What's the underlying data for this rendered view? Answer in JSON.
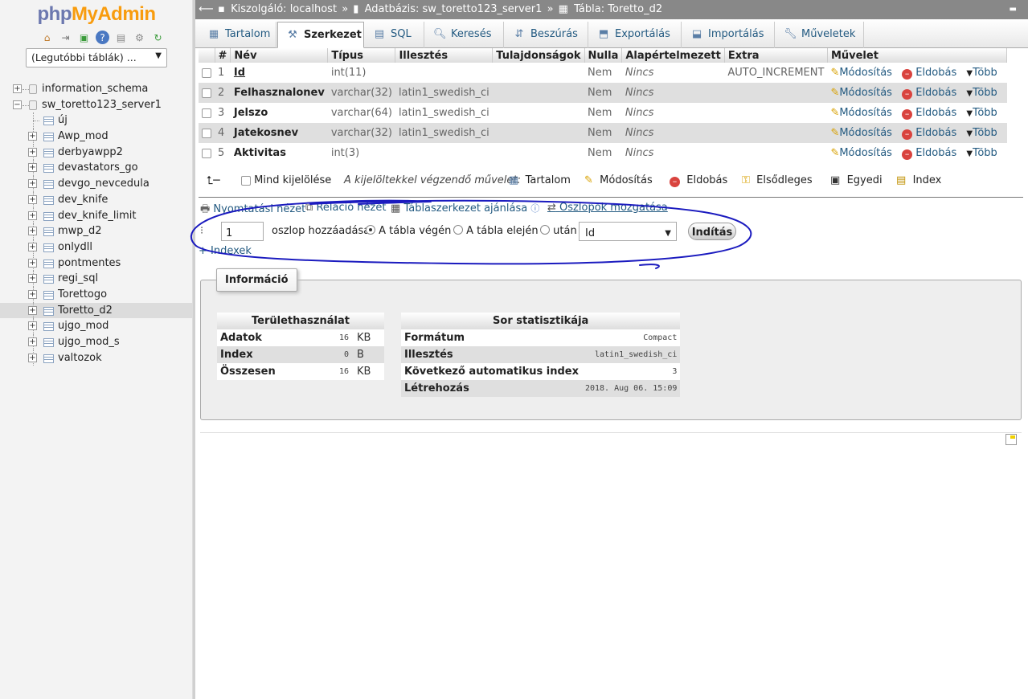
{
  "logo": {
    "php": "php",
    "myadmin": "MyAdmin"
  },
  "nav": {
    "recent_tables": "(Legutóbbi táblák) ...",
    "tree": [
      {
        "label": "information_schema",
        "kind": "db",
        "expanded": false
      },
      {
        "label": "sw_toretto123_server1",
        "kind": "db",
        "expanded": true
      },
      {
        "label": "új",
        "kind": "new"
      },
      {
        "label": "Awp_mod",
        "kind": "table"
      },
      {
        "label": "derbyawpp2",
        "kind": "table"
      },
      {
        "label": "devastators_go",
        "kind": "table"
      },
      {
        "label": "devgo_nevcedula",
        "kind": "table"
      },
      {
        "label": "dev_knife",
        "kind": "table"
      },
      {
        "label": "dev_knife_limit",
        "kind": "table"
      },
      {
        "label": "mwp_d2",
        "kind": "table"
      },
      {
        "label": "onlydll",
        "kind": "table"
      },
      {
        "label": "pontmentes",
        "kind": "table"
      },
      {
        "label": "regi_sql",
        "kind": "table"
      },
      {
        "label": "Torettogo",
        "kind": "table"
      },
      {
        "label": "Toretto_d2",
        "kind": "table",
        "selected": true
      },
      {
        "label": "ujgo_mod",
        "kind": "table"
      },
      {
        "label": "ujgo_mod_s",
        "kind": "table"
      },
      {
        "label": "valtozok",
        "kind": "table"
      }
    ]
  },
  "breadcrumb": {
    "server": "Kiszolgáló: localhost",
    "database": "Adatbázis: sw_toretto123_server1",
    "table": "Tábla: Toretto_d2"
  },
  "tabs": [
    {
      "label": "Tartalom",
      "icon": "table-icon"
    },
    {
      "label": "Szerkezet",
      "icon": "structure-icon",
      "active": true
    },
    {
      "label": "SQL",
      "icon": "sql-icon"
    },
    {
      "label": "Keresés",
      "icon": "search-icon"
    },
    {
      "label": "Beszúrás",
      "icon": "insert-icon"
    },
    {
      "label": "Exportálás",
      "icon": "export-icon"
    },
    {
      "label": "Importálás",
      "icon": "import-icon"
    },
    {
      "label": "Műveletek",
      "icon": "wrench-icon"
    }
  ],
  "structure": {
    "headers": [
      "#",
      "Név",
      "Típus",
      "Illesztés",
      "Tulajdonságok",
      "Nulla",
      "Alapértelmezett",
      "Extra",
      "Művelet"
    ],
    "rows": [
      {
        "num": "1",
        "name": "Id",
        "type": "int(11)",
        "collation": "",
        "attributes": "",
        "null": "Nem",
        "default": "Nincs",
        "extra": "AUTO_INCREMENT"
      },
      {
        "num": "2",
        "name": "Felhasznalonev",
        "type": "varchar(32)",
        "collation": "latin1_swedish_ci",
        "attributes": "",
        "null": "Nem",
        "default": "Nincs",
        "extra": ""
      },
      {
        "num": "3",
        "name": "Jelszo",
        "type": "varchar(64)",
        "collation": "latin1_swedish_ci",
        "attributes": "",
        "null": "Nem",
        "default": "Nincs",
        "extra": ""
      },
      {
        "num": "4",
        "name": "Jatekosnev",
        "type": "varchar(32)",
        "collation": "latin1_swedish_ci",
        "attributes": "",
        "null": "Nem",
        "default": "Nincs",
        "extra": ""
      },
      {
        "num": "5",
        "name": "Aktivitas",
        "type": "int(3)",
        "collation": "",
        "attributes": "",
        "null": "Nem",
        "default": "Nincs",
        "extra": ""
      }
    ],
    "actions": {
      "modify": "Módosítás",
      "drop": "Eldobás",
      "more": "Több"
    }
  },
  "bulk": {
    "check_all": "Mind kijelölése",
    "with_selected": "A kijelöltekkel végzendő művelet:",
    "browse": "Tartalom",
    "modify": "Módosítás",
    "drop": "Eldobás",
    "primary": "Elsődleges",
    "unique": "Egyedi",
    "index": "Index"
  },
  "table_links": {
    "print_view": "Nyomtatási nézet",
    "relation_view": "Reláció nézet",
    "propose_structure": "Táblaszerkezet ajánlása",
    "move_columns": "Oszlopok mozgatása"
  },
  "add_column": {
    "count": "1",
    "label": "oszlop hozzáadása",
    "at_end": "A tábla végén",
    "at_beginning": "A tábla elején",
    "after": "után",
    "after_column": "Id",
    "go": "Indítás"
  },
  "indexes_link": "+ Indexek",
  "info": {
    "legend": "Információ",
    "space": {
      "title": "Területhasználat",
      "rows": [
        {
          "label": "Adatok",
          "value": "16",
          "unit": "KB"
        },
        {
          "label": "Index",
          "value": "0",
          "unit": "B"
        },
        {
          "label": "Összesen",
          "value": "16",
          "unit": "KB"
        }
      ]
    },
    "row_stats": {
      "title": "Sor statisztikája",
      "rows": [
        {
          "label": "Formátum",
          "value": "Compact"
        },
        {
          "label": "Illesztés",
          "value": "latin1_swedish_ci"
        },
        {
          "label": "Következő automatikus index",
          "value": "3"
        },
        {
          "label": "Létrehozás",
          "value": "2018. Aug 06. 15:09"
        }
      ]
    }
  },
  "colors": {
    "link": "#235a81",
    "topbar": "#888888",
    "drop": "#d9433e",
    "annotation": "#1b1bbf"
  }
}
